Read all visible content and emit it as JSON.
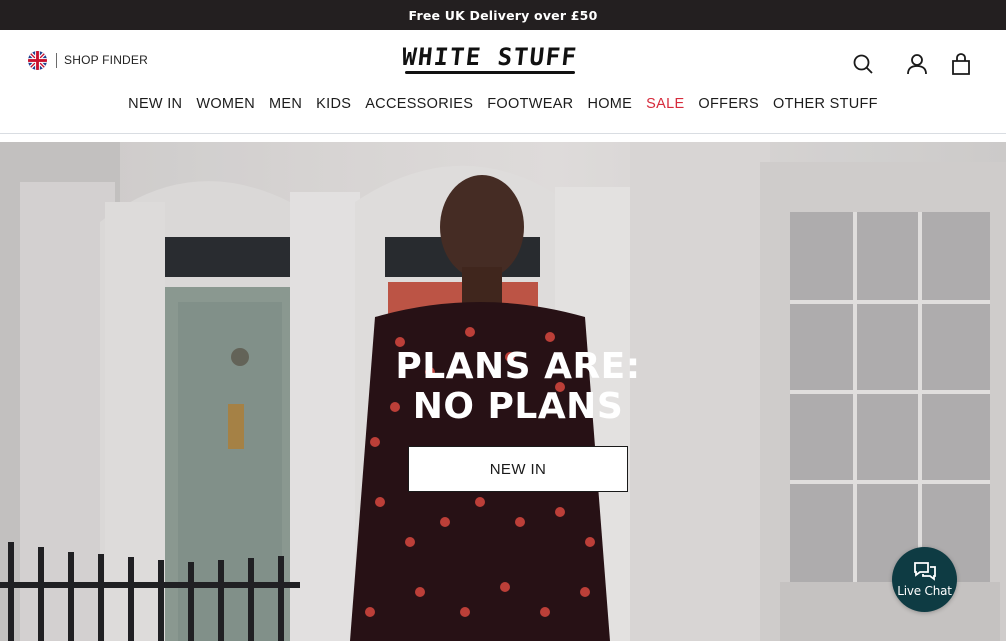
{
  "promo_bar": {
    "text": "Free UK Delivery over £50"
  },
  "header": {
    "shop_finder_label": "SHOP FINDER",
    "flag_icon": "uk-flag-icon",
    "logo_text": "WHITE STUFF",
    "icons": [
      "search-icon",
      "account-icon",
      "bag-icon"
    ]
  },
  "nav": {
    "items": [
      {
        "label": "NEW IN"
      },
      {
        "label": "WOMEN"
      },
      {
        "label": "MEN"
      },
      {
        "label": "KIDS"
      },
      {
        "label": "ACCESSORIES"
      },
      {
        "label": "FOOTWEAR"
      },
      {
        "label": "HOME"
      },
      {
        "label": "SALE"
      },
      {
        "label": "OFFERS"
      },
      {
        "label": "OTHER STUFF"
      }
    ]
  },
  "hero": {
    "headline_line1": "PLANS ARE:",
    "headline_line2": "NO PLANS",
    "cta_label": "NEW IN"
  },
  "live_chat": {
    "label": "Live Chat",
    "icon": "chat-bubbles-icon"
  },
  "colors": {
    "promo_bg": "#231f20",
    "sale": "#d62b3c",
    "chat_bg": "#0e3b43"
  }
}
